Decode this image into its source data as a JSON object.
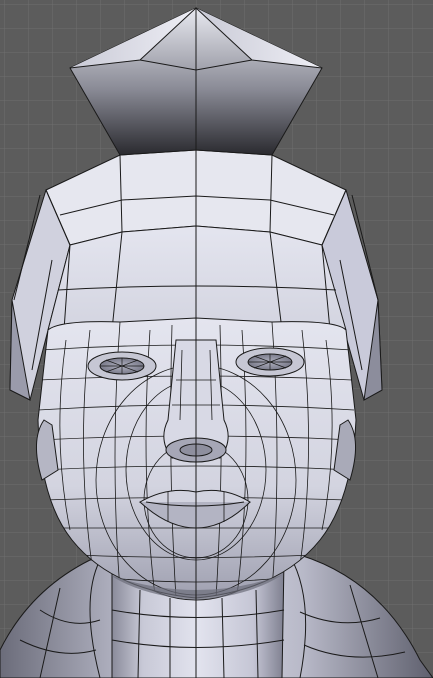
{
  "viewport": {
    "background_color": "#5c5c5c",
    "grid_color": "#6e6e6e",
    "wire_color": "#1a1a1a",
    "mesh_fill_light": "#d7d8e6",
    "mesh_fill_shadow": "#7d7e8c"
  },
  "model": {
    "subject": "head-and-shoulders-mesh",
    "display": "solid-shaded-with-wireframe",
    "symmetry": "mirrored-at-center-line"
  }
}
